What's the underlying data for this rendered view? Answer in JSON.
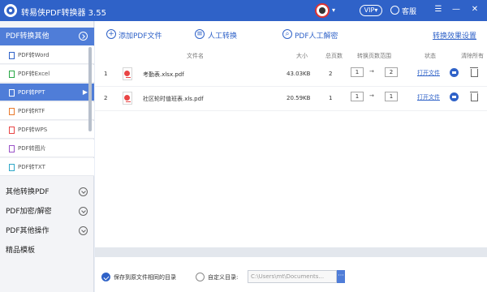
{
  "app": {
    "title": "转易侠PDF转换器 3.55",
    "vip_label": "VIP",
    "vip_caret": "▾",
    "support_label": "客服",
    "window_controls": [
      "menu-icon",
      "minimize-icon",
      "close-icon"
    ],
    "user_caret": "▾"
  },
  "sidebar": {
    "active_section": "PDF转换其他",
    "sub_items": [
      {
        "label": "PDF转Word",
        "icon": "word-file-icon"
      },
      {
        "label": "PDF转Excel",
        "icon": "excel-file-icon"
      },
      {
        "label": "PDF转PPT",
        "icon": "ppt-file-icon",
        "active": true
      },
      {
        "label": "PDF转RTF",
        "icon": "rtf-file-icon"
      },
      {
        "label": "PDF转WPS",
        "icon": "wps-file-icon"
      },
      {
        "label": "PDF转图片",
        "icon": "image-file-icon"
      },
      {
        "label": "PDF转TXT",
        "icon": "txt-file-icon"
      }
    ],
    "sections": [
      {
        "label": "其他转换PDF"
      },
      {
        "label": "PDF加密/解密"
      },
      {
        "label": "PDF其他操作"
      },
      {
        "label": "精品模板"
      }
    ]
  },
  "toolbar": {
    "add_pdf": "添加PDF文件",
    "manual_convert": "人工转换",
    "manual_decrypt": "PDF人工解密",
    "settings_link": "转换效果设置"
  },
  "table": {
    "headers": {
      "name": "文件名",
      "size": "大小",
      "pages": "总页数",
      "range": "转换页数范围",
      "status": "状态",
      "clear": "清除所有"
    },
    "rows": [
      {
        "index": "1",
        "filename": "考勤表.xlsx.pdf",
        "size": "43.03KB",
        "pages": "2",
        "from": "1",
        "to": "2",
        "action": "打开文件"
      },
      {
        "index": "2",
        "filename": "社区轮时值班表.xls.pdf",
        "size": "20.59KB",
        "pages": "1",
        "from": "1",
        "to": "1",
        "action": "打开文件"
      }
    ],
    "range_arrow": "→"
  },
  "footer": {
    "save_same_label": "保存到原文件相同的目录",
    "custom_label": "自定义目录:",
    "custom_path": "C:\\Users\\mt\\Documents...",
    "browse_label": "···"
  },
  "colors": {
    "brand": "#2f62c8",
    "sidebar_active": "#4f7dd8",
    "pdf_red": "#e94545"
  }
}
